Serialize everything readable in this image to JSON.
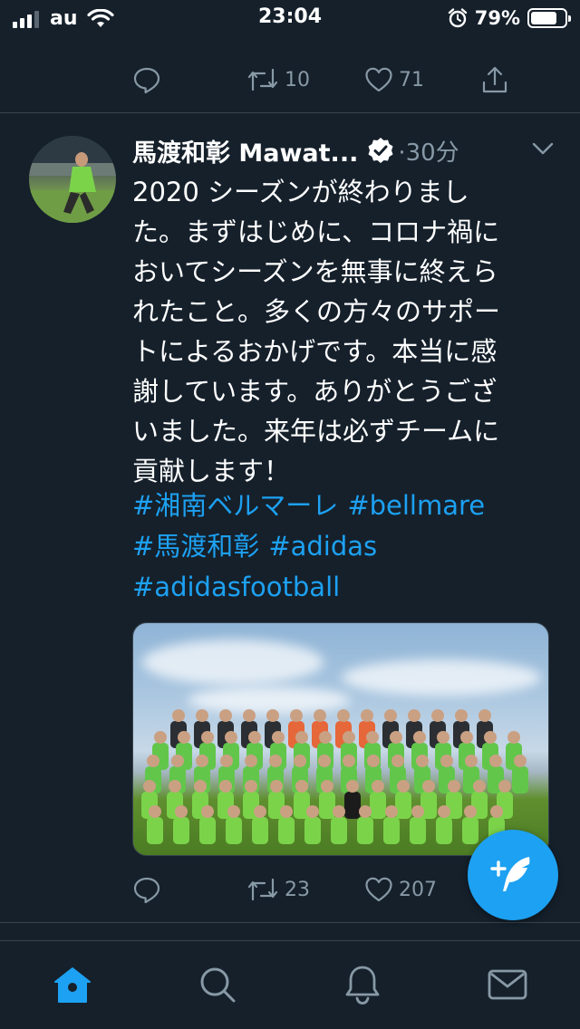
{
  "status_bar": {
    "carrier": "au",
    "time": "23:04",
    "battery_percent": "79%",
    "battery_level": 0.79,
    "signal_bars": 3
  },
  "previous_tweet": {
    "retweet_count": "10",
    "like_count": "71"
  },
  "tweet": {
    "display_name": "馬渡和彰 Mawat...",
    "verified": true,
    "time": "·30分",
    "text_lines": [
      "2020 シーズンが終わりまし",
      "た。まずはじめに、コロナ禍に",
      "おいてシーズンを無事に終えら",
      "れたこと。多くの方々のサポー",
      "トによるおかげです。本当に感",
      "謝しています。ありがとうござ",
      "いました。来年は必ずチームに",
      "貢献します！"
    ],
    "hashtags": [
      "#湘南ベルマーレ",
      "#bellmare",
      "#馬渡和彰",
      "#adidas",
      "#adidasfootball"
    ],
    "retweet_count": "23",
    "like_count": "207"
  },
  "tab_bar": {
    "items": [
      "home-icon",
      "search-icon",
      "notifications-icon",
      "messages-icon"
    ],
    "active": "home-icon"
  },
  "colors": {
    "background": "#15202b",
    "accent": "#1da1f2",
    "muted": "#8899a6",
    "divider": "#38444d"
  }
}
